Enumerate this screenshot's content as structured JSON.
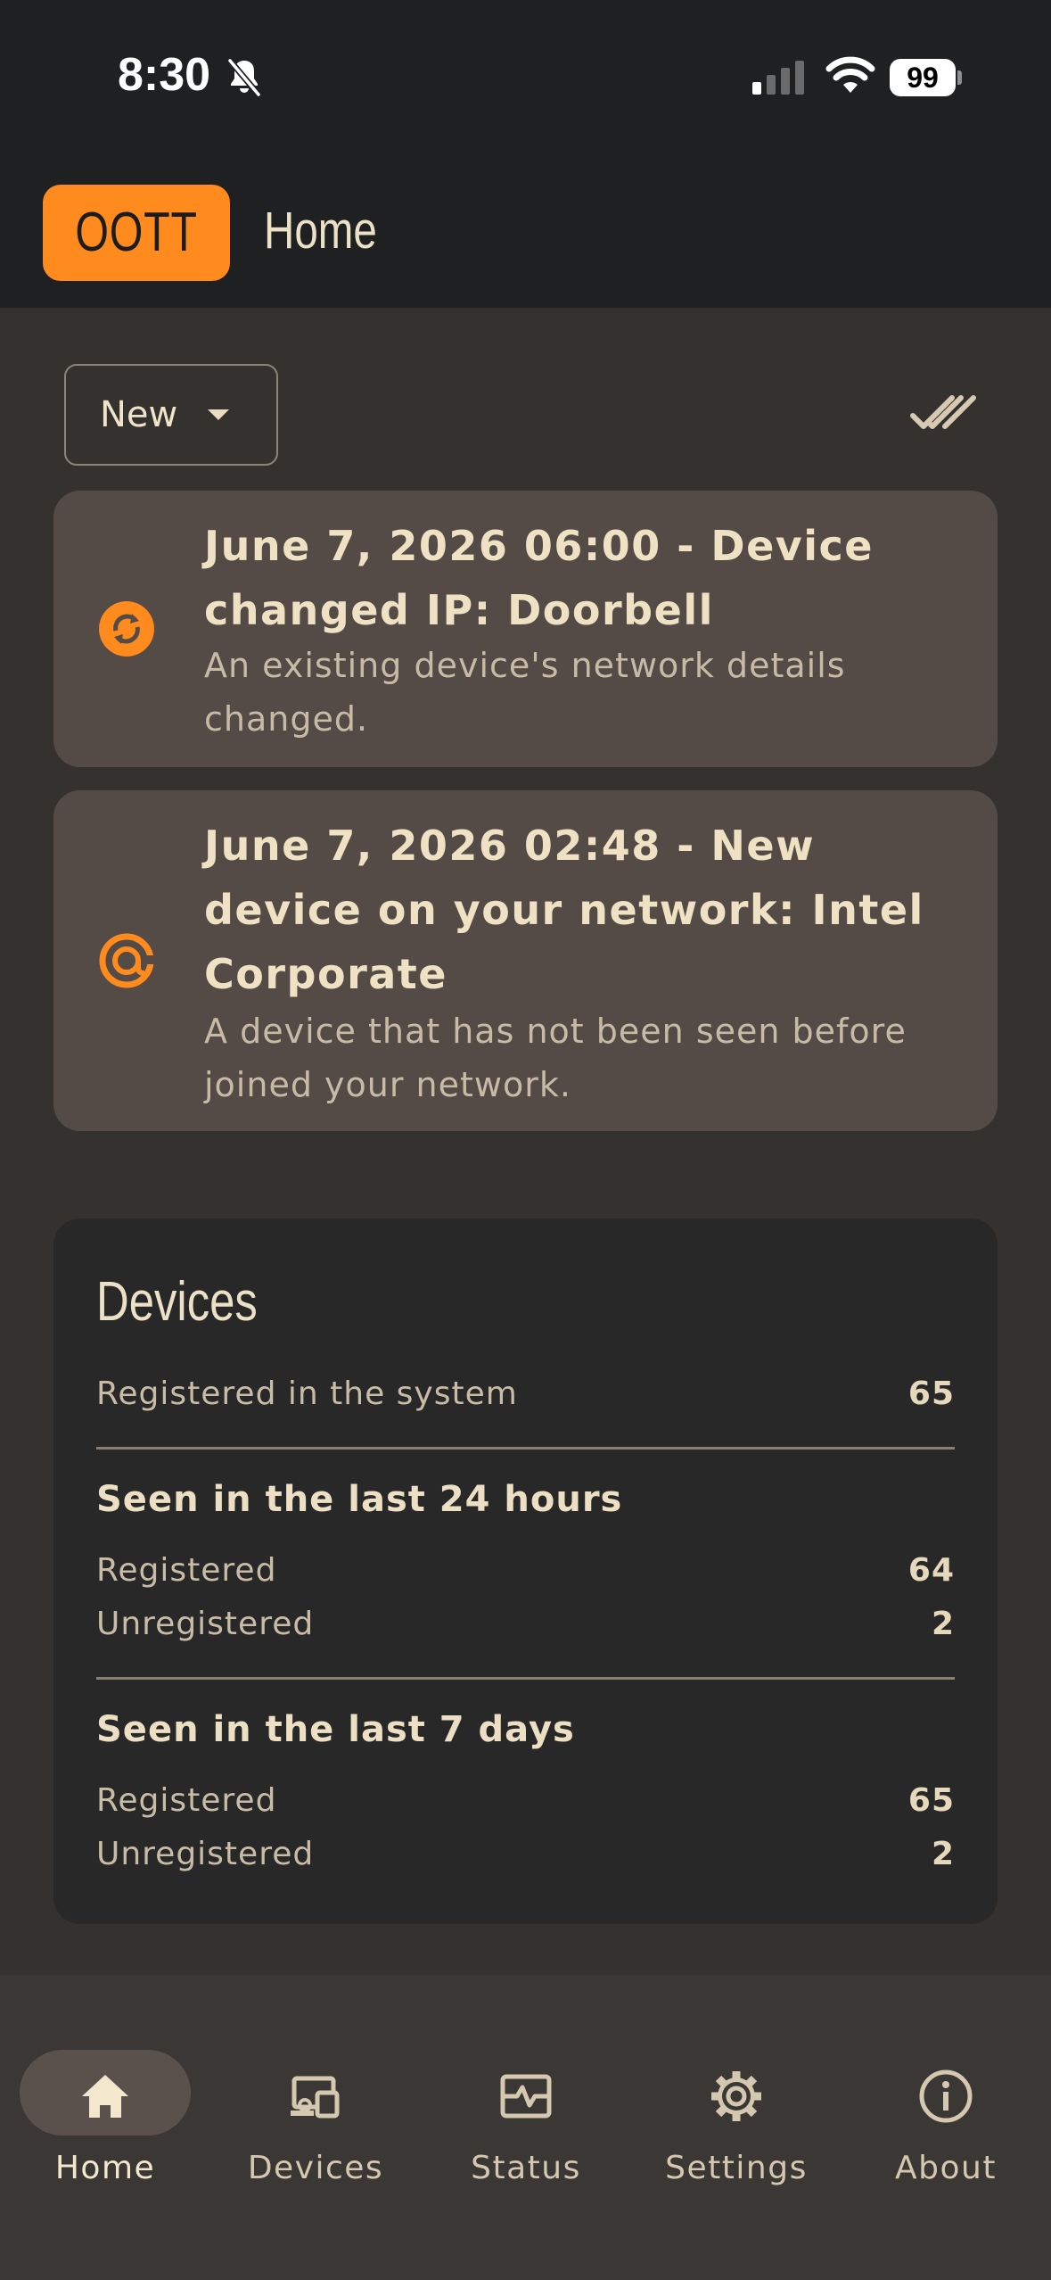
{
  "status_bar": {
    "time": "8:30",
    "battery": "99",
    "icons": [
      "bell-slash-icon",
      "cellular-signal-icon",
      "wifi-icon",
      "battery-icon"
    ]
  },
  "app_bar": {
    "logo": "OOTT",
    "title": "Home",
    "logo_color": "#ff8a1d"
  },
  "filter": {
    "selected": "New",
    "mark_all_icon": "double-check-icon"
  },
  "notifications": [
    {
      "icon": "ip-change-icon",
      "title": "June 7, 2026 06:00 - Device changed IP: Doorbell",
      "body": "An existing device's network details changed."
    },
    {
      "icon": "new-device-icon",
      "title": "June 7, 2026 02:48 - New device on your network: Intel Corporate",
      "body": "A device that has not been seen before joined your network."
    }
  ],
  "devices": {
    "title": "Devices",
    "registered_label": "Registered in the system",
    "registered_value": "65",
    "last24": {
      "heading": "Seen in the last 24 hours",
      "registered_label": "Registered",
      "registered_value": "64",
      "unregistered_label": "Unregistered",
      "unregistered_value": "2"
    },
    "last7": {
      "heading": "Seen in the last 7 days",
      "registered_label": "Registered",
      "registered_value": "65",
      "unregistered_label": "Unregistered",
      "unregistered_value": "2"
    }
  },
  "nav": [
    {
      "label": "Home",
      "icon": "home-icon",
      "active": true
    },
    {
      "label": "Devices",
      "icon": "devices-icon",
      "active": false
    },
    {
      "label": "Status",
      "icon": "status-icon",
      "active": false
    },
    {
      "label": "Settings",
      "icon": "gear-icon",
      "active": false
    },
    {
      "label": "About",
      "icon": "info-icon",
      "active": false
    }
  ],
  "colors": {
    "accent": "#ff8a1d",
    "background": "#34312f",
    "card": "#544b47",
    "panel": "#282828",
    "text": "#e9dcc0"
  }
}
